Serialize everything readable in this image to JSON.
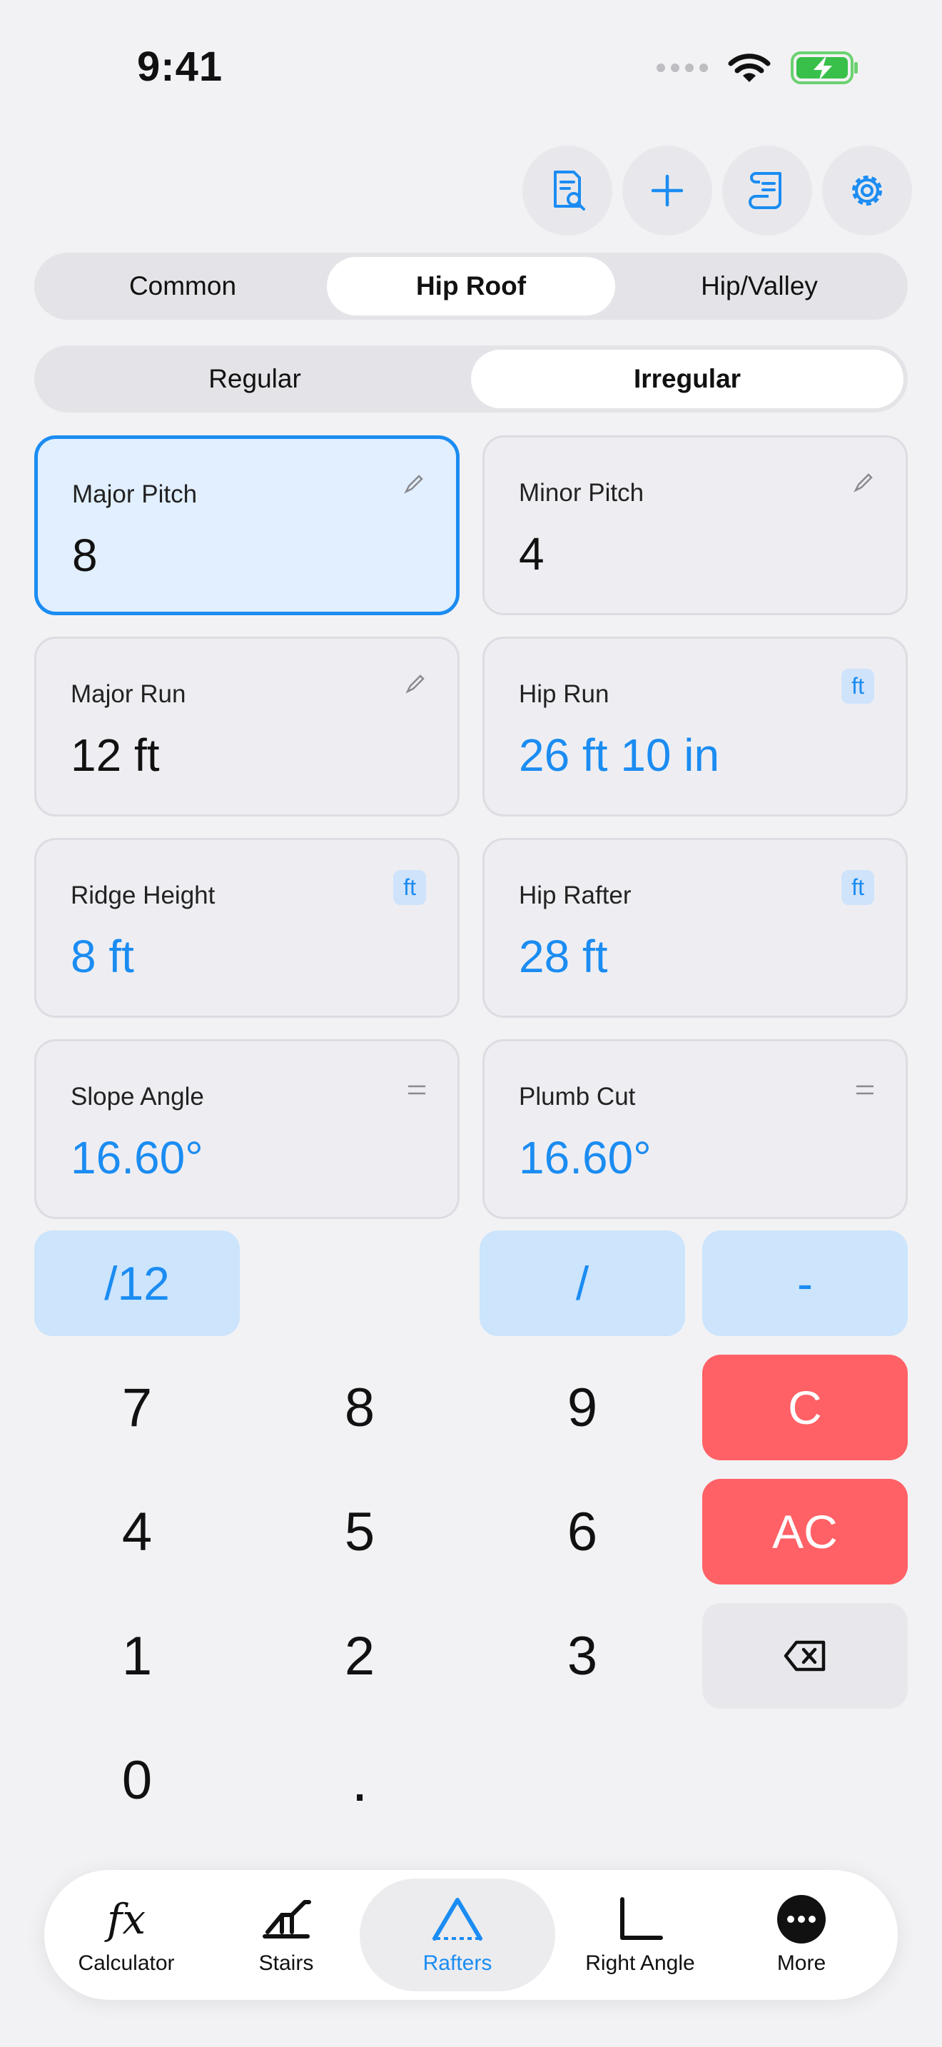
{
  "status_bar": {
    "time": "9:41"
  },
  "toolbar": {
    "buttons": [
      "document-search-icon",
      "plus-icon",
      "scroll-icon",
      "gear-icon"
    ],
    "accent": "#1b8cf2"
  },
  "roof_type": {
    "options": [
      "Common",
      "Hip Roof",
      "Hip/Valley"
    ],
    "selected": "Hip Roof"
  },
  "hip_type": {
    "options": [
      "Regular",
      "Irregular"
    ],
    "selected": "Irregular"
  },
  "fields": {
    "major_pitch": {
      "label": "Major Pitch",
      "value": "8"
    },
    "minor_pitch": {
      "label": "Minor Pitch",
      "value": "4"
    },
    "major_run": {
      "label": "Major Run",
      "value": "12 ft"
    },
    "hip_run": {
      "label": "Hip Run",
      "value": "26 ft 10 in",
      "unit": "ft"
    },
    "ridge_height": {
      "label": "Ridge Height",
      "value": "8 ft",
      "unit": "ft"
    },
    "hip_rafter": {
      "label": "Hip Rafter",
      "value": "28 ft",
      "unit": "ft"
    },
    "slope_angle": {
      "label": "Slope Angle",
      "value": "16.60°"
    },
    "plumb_cut": {
      "label": "Plumb Cut",
      "value": "16.60°"
    }
  },
  "keypad": {
    "over12": "/12",
    "slash": "/",
    "minus": "-",
    "k7": "7",
    "k8": "8",
    "k9": "9",
    "clear": "C",
    "k4": "4",
    "k5": "5",
    "k6": "6",
    "all_clear": "AC",
    "k1": "1",
    "k2": "2",
    "k3": "3",
    "k0": "0",
    "dot": ".",
    "clear_color": "#ff6166"
  },
  "tabbar": {
    "calculator": {
      "icon": "fx",
      "label": "Calculator"
    },
    "stairs": {
      "label": "Stairs"
    },
    "rafters": {
      "label": "Rafters"
    },
    "right_angle": {
      "label": "Right Angle"
    },
    "more": {
      "label": "More"
    },
    "selected": "Rafters"
  }
}
